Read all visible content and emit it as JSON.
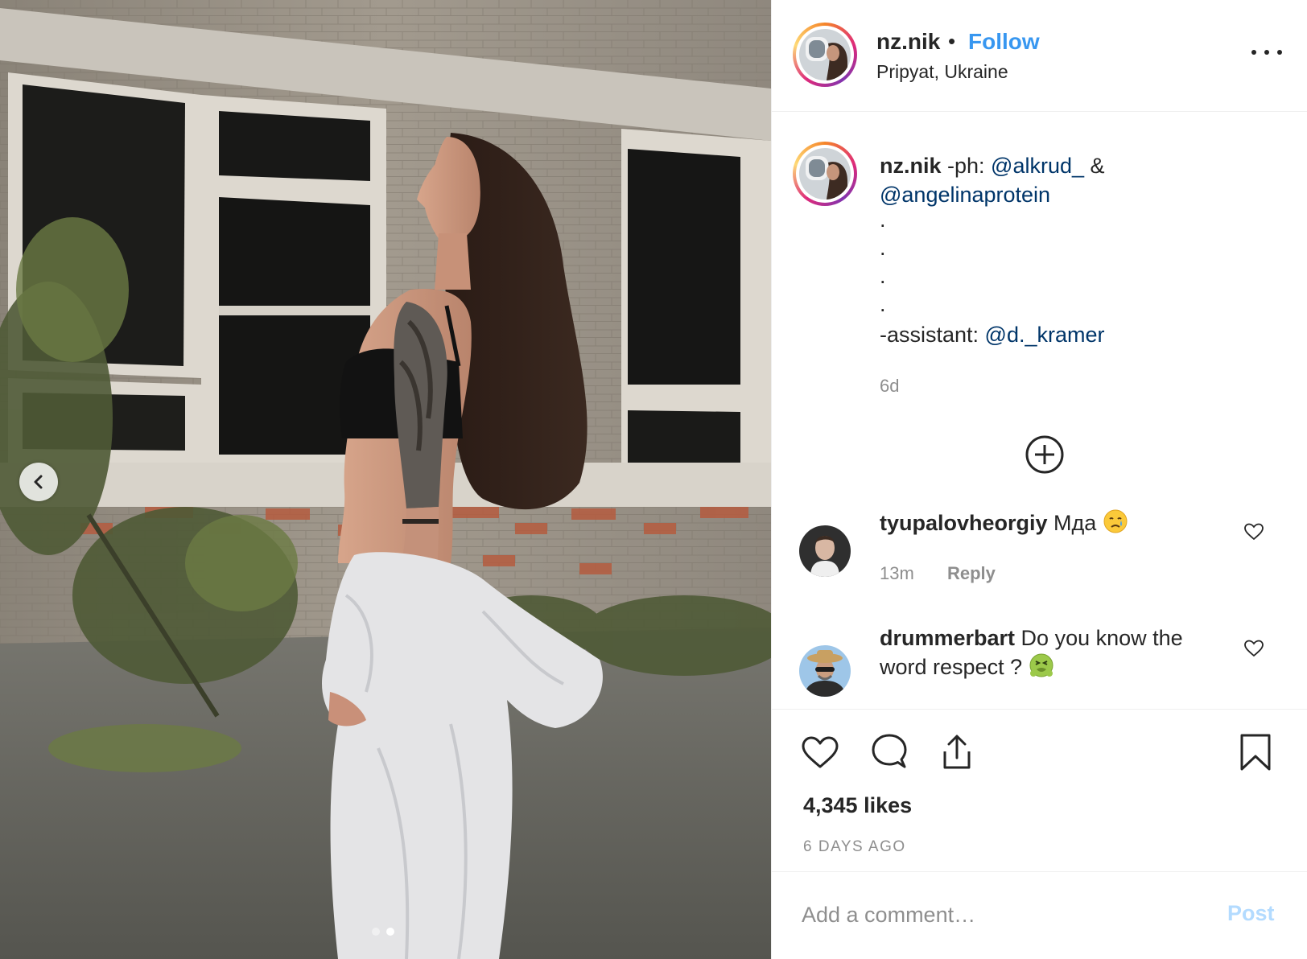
{
  "post": {
    "username": "nz.nik",
    "separator": "•",
    "follow_label": "Follow",
    "location": "Pripyat, Ukraine"
  },
  "caption": {
    "username": "nz.nik",
    "text_before": " -ph: ",
    "mention_1": "@alkrud_",
    "amp": " &",
    "mention_2": "@angelinaprotein",
    "dots": [
      ".",
      ".",
      ".",
      "."
    ],
    "assistant_label": "-assistant: ",
    "mention_3": "@d._kramer",
    "time": "6d"
  },
  "comments": [
    {
      "username": "tyupalovheorgiy",
      "text": " Мда ",
      "emoji": "crying-face",
      "time": "13m",
      "reply_label": "Reply"
    },
    {
      "username": "drummerbart",
      "text": " Do you know the word respect ? ",
      "emoji": "nauseated-face"
    }
  ],
  "stats": {
    "likes": "4,345 likes",
    "posted": "6 DAYS AGO"
  },
  "comment_box": {
    "placeholder": "Add a comment…",
    "post_label": "Post"
  },
  "carousel": {
    "slides": 2,
    "active_index": 1
  },
  "colors": {
    "accent": "#3897f0",
    "mention": "#003569",
    "muted": "#8e8e8e",
    "post_disabled": "#b3dbff"
  }
}
